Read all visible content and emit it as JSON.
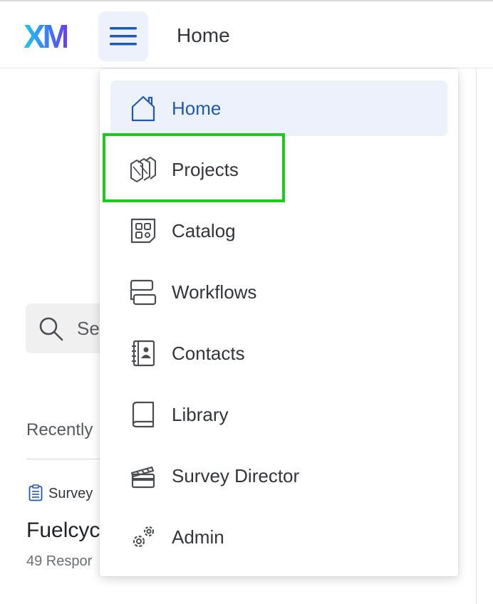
{
  "header": {
    "logo_text": "XM",
    "page_title": "Home"
  },
  "background": {
    "search_placeholder": "Se",
    "recent_label": "Recently",
    "survey_type": "Survey",
    "survey_name": "Fuelcyc",
    "survey_responses": "49 Respor"
  },
  "nav": {
    "items": [
      {
        "label": "Home",
        "icon": "home-icon",
        "active": true
      },
      {
        "label": "Projects",
        "icon": "projects-icon",
        "active": false
      },
      {
        "label": "Catalog",
        "icon": "catalog-icon",
        "active": false
      },
      {
        "label": "Workflows",
        "icon": "workflows-icon",
        "active": false
      },
      {
        "label": "Contacts",
        "icon": "contacts-icon",
        "active": false
      },
      {
        "label": "Library",
        "icon": "library-icon",
        "active": false
      },
      {
        "label": "Survey Director",
        "icon": "survey-director-icon",
        "active": false
      },
      {
        "label": "Admin",
        "icon": "admin-icon",
        "active": false
      }
    ]
  },
  "colors": {
    "accent": "#1e5ab4",
    "active_bg": "#edf1fb",
    "highlight": "#1ccb1c"
  }
}
